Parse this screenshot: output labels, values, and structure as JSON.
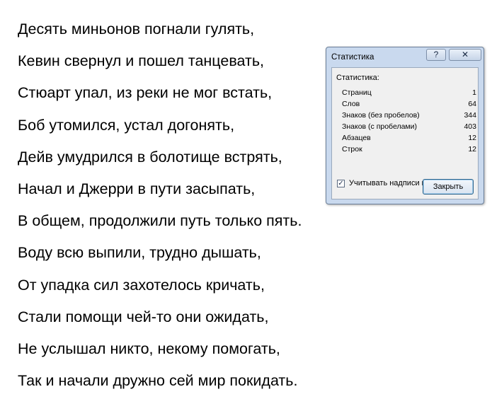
{
  "poem": {
    "lines": [
      "Десять миньонов погнали гулять,",
      "Кевин свернул и пошел танцевать,",
      "Стюарт упал, из реки не мог встать,",
      "Боб утомился, устал догонять,",
      "Дейв умудрился в болотище встрять,",
      "Начал и Джерри в пути засыпать,",
      "В общем, продолжили путь только пять.",
      "Воду всю выпили, трудно дышать,",
      "От упадка сил захотелось кричать,",
      "Стали помощи чей-то они ожидать,",
      "Не услышал никто, некому помогать,",
      "Так и начали дружно сей мир покидать."
    ]
  },
  "dialog": {
    "title": "Статистика",
    "help_glyph": "?",
    "close_glyph": "✕",
    "group_label": "Статистика:",
    "stats": [
      {
        "label": "Страниц",
        "value": "1"
      },
      {
        "label": "Слов",
        "value": "64"
      },
      {
        "label": "Знаков (без пробелов)",
        "value": "344"
      },
      {
        "label": "Знаков (с пробелами)",
        "value": "403"
      },
      {
        "label": "Абзацев",
        "value": "12"
      },
      {
        "label": "Строк",
        "value": "12"
      }
    ],
    "checkbox_label": "Учитывать надписи и сноски",
    "checkbox_checked": true,
    "close_button_label": "Закрыть"
  }
}
